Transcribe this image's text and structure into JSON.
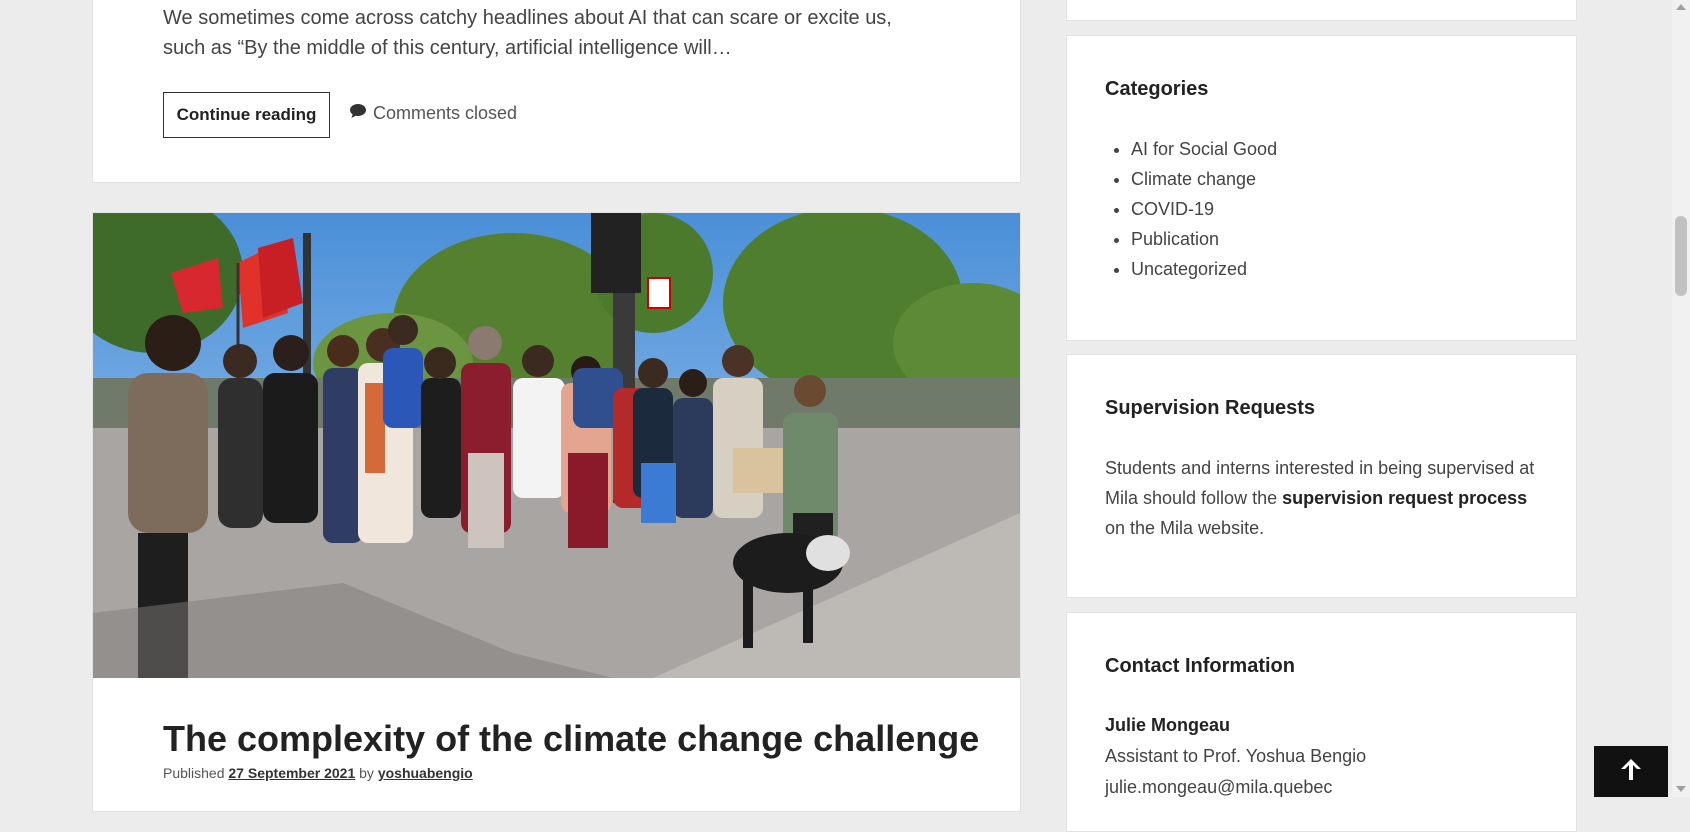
{
  "post1": {
    "excerpt": "We sometimes come across catchy headlines about AI that can scare or excite us, such as “By the middle of this century, artificial intelligence will…",
    "continue_label": "Continue reading",
    "comments_label": "Comments closed",
    "comment_icon": "speech-bubble-icon"
  },
  "post2": {
    "image_alt": "Group of students wearing masks at a climate march",
    "title": "The complexity of the climate change challenge",
    "published_prefix": "Published",
    "date": "27 September 2021",
    "by": "by",
    "author": "yoshuabengio"
  },
  "sidebar": {
    "categories": {
      "title": "Categories",
      "items": [
        "AI for Social Good",
        "Climate change",
        "COVID-19",
        "Publication",
        "Uncategorized"
      ]
    },
    "supervision": {
      "title": "Supervision Requests",
      "text_before": "Students and interns interested in being supervised at Mila should follow the ",
      "link": "supervision request process",
      "text_after": " on the Mila website."
    },
    "contact": {
      "title": "Contact Information",
      "name": "Julie Mongeau",
      "role": "Assistant to Prof. Yoshua Bengio",
      "email": "julie.mongeau@mila.quebec"
    }
  },
  "back_to_top_icon": "arrow-up-icon"
}
